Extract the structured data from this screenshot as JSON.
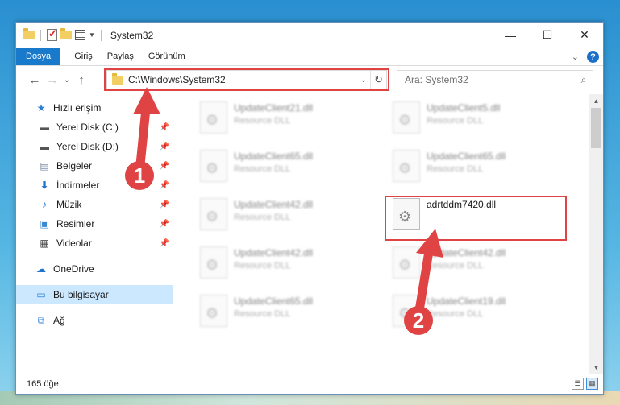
{
  "window": {
    "title": "System32",
    "controls": {
      "minimize": "—",
      "maximize": "☐",
      "close": "✕"
    }
  },
  "quick_access_toolbar": {
    "icons": [
      "folder-icon",
      "properties-check-icon",
      "new-folder-icon",
      "properties-icon"
    ]
  },
  "ribbon": {
    "tabs": [
      "Dosya",
      "Giriş",
      "Paylaş",
      "Görünüm"
    ],
    "help": "?",
    "expand": "⌄"
  },
  "navigation": {
    "back": "←",
    "forward": "→",
    "recent": "⌄",
    "up": "↑",
    "address": "C:\\Windows\\System32",
    "address_dropdown": "⌄",
    "refresh": "↻",
    "search_placeholder": "Ara: System32",
    "search_icon": "⌕"
  },
  "nav_pane": {
    "quick_access": "Hızlı erişim",
    "items": [
      {
        "label": "Yerel Disk (C:)",
        "icon": "drive-icon",
        "pinned": true
      },
      {
        "label": "Yerel Disk (D:)",
        "icon": "drive-icon",
        "pinned": true
      },
      {
        "label": "Belgeler",
        "icon": "documents-icon",
        "pinned": true
      },
      {
        "label": "İndirmeler",
        "icon": "downloads-icon",
        "pinned": true
      },
      {
        "label": "Müzik",
        "icon": "music-icon",
        "pinned": true
      },
      {
        "label": "Resimler",
        "icon": "pictures-icon",
        "pinned": true
      },
      {
        "label": "Videolar",
        "icon": "videos-icon",
        "pinned": true
      }
    ],
    "onedrive": "OneDrive",
    "this_pc": "Bu bilgisayar",
    "network": "Ağ"
  },
  "files": {
    "items": [
      {
        "name": "UpdateClient21.dll",
        "desc": "Resource DLL",
        "blurred": true
      },
      {
        "name": "UpdateClient5.dll",
        "desc": "Resource DLL",
        "blurred": true
      },
      {
        "name": "UpdateClient65.dll",
        "desc": "Resource DLL",
        "blurred": true
      },
      {
        "name": "UpdateClient65.dll",
        "desc": "Resource DLL",
        "blurred": true
      },
      {
        "name": "UpdateClient42.dll",
        "desc": "Resource DLL",
        "blurred": true
      },
      {
        "name": "adrtddm7420.dll",
        "desc": "",
        "blurred": false
      },
      {
        "name": "UpdateClient42.dll",
        "desc": "Resource DLL",
        "blurred": true
      },
      {
        "name": "UpdateClient42.dll",
        "desc": "Resource DLL",
        "blurred": true
      },
      {
        "name": "UpdateClient65.dll",
        "desc": "Resource DLL",
        "blurred": true
      },
      {
        "name": "UpdateClient19.dll",
        "desc": "Resource DLL",
        "blurred": true
      }
    ]
  },
  "status": {
    "count": "165 öğe"
  },
  "annotations": {
    "step1": "1",
    "step2": "2",
    "color": "#e04343"
  }
}
